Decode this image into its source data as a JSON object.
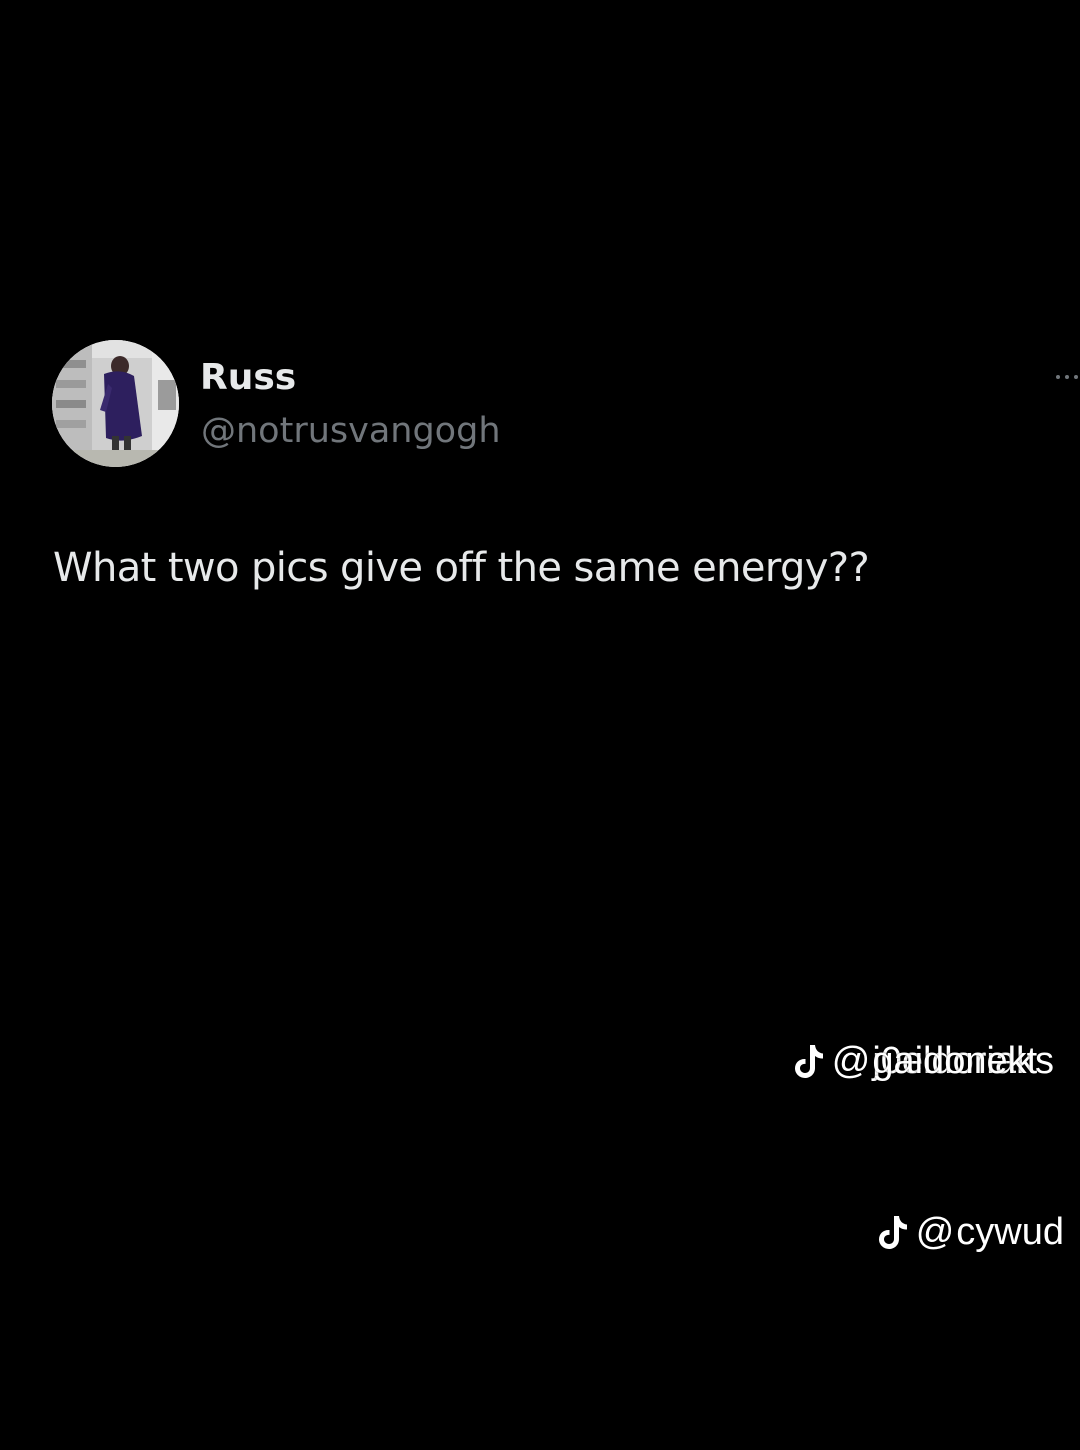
{
  "post": {
    "author": {
      "name": "Russ",
      "handle": "@notrusvangogh",
      "avatar": "profile-photo"
    },
    "text": "What two pics give off the same energy??",
    "more_icon": "more-horizontal-icon"
  },
  "watermarks": [
    {
      "icon": "tiktok-icon",
      "at": "@",
      "username_layer_a": "j0eldoriaks",
      "username_layer_b": "gaidonekt"
    },
    {
      "icon": "tiktok-icon",
      "at": "@",
      "username": "cywud"
    }
  ],
  "colors": {
    "background": "#000000",
    "primary_text": "#e7e9ea",
    "secondary_text": "#71767b",
    "watermark_text": "#ffffff"
  }
}
